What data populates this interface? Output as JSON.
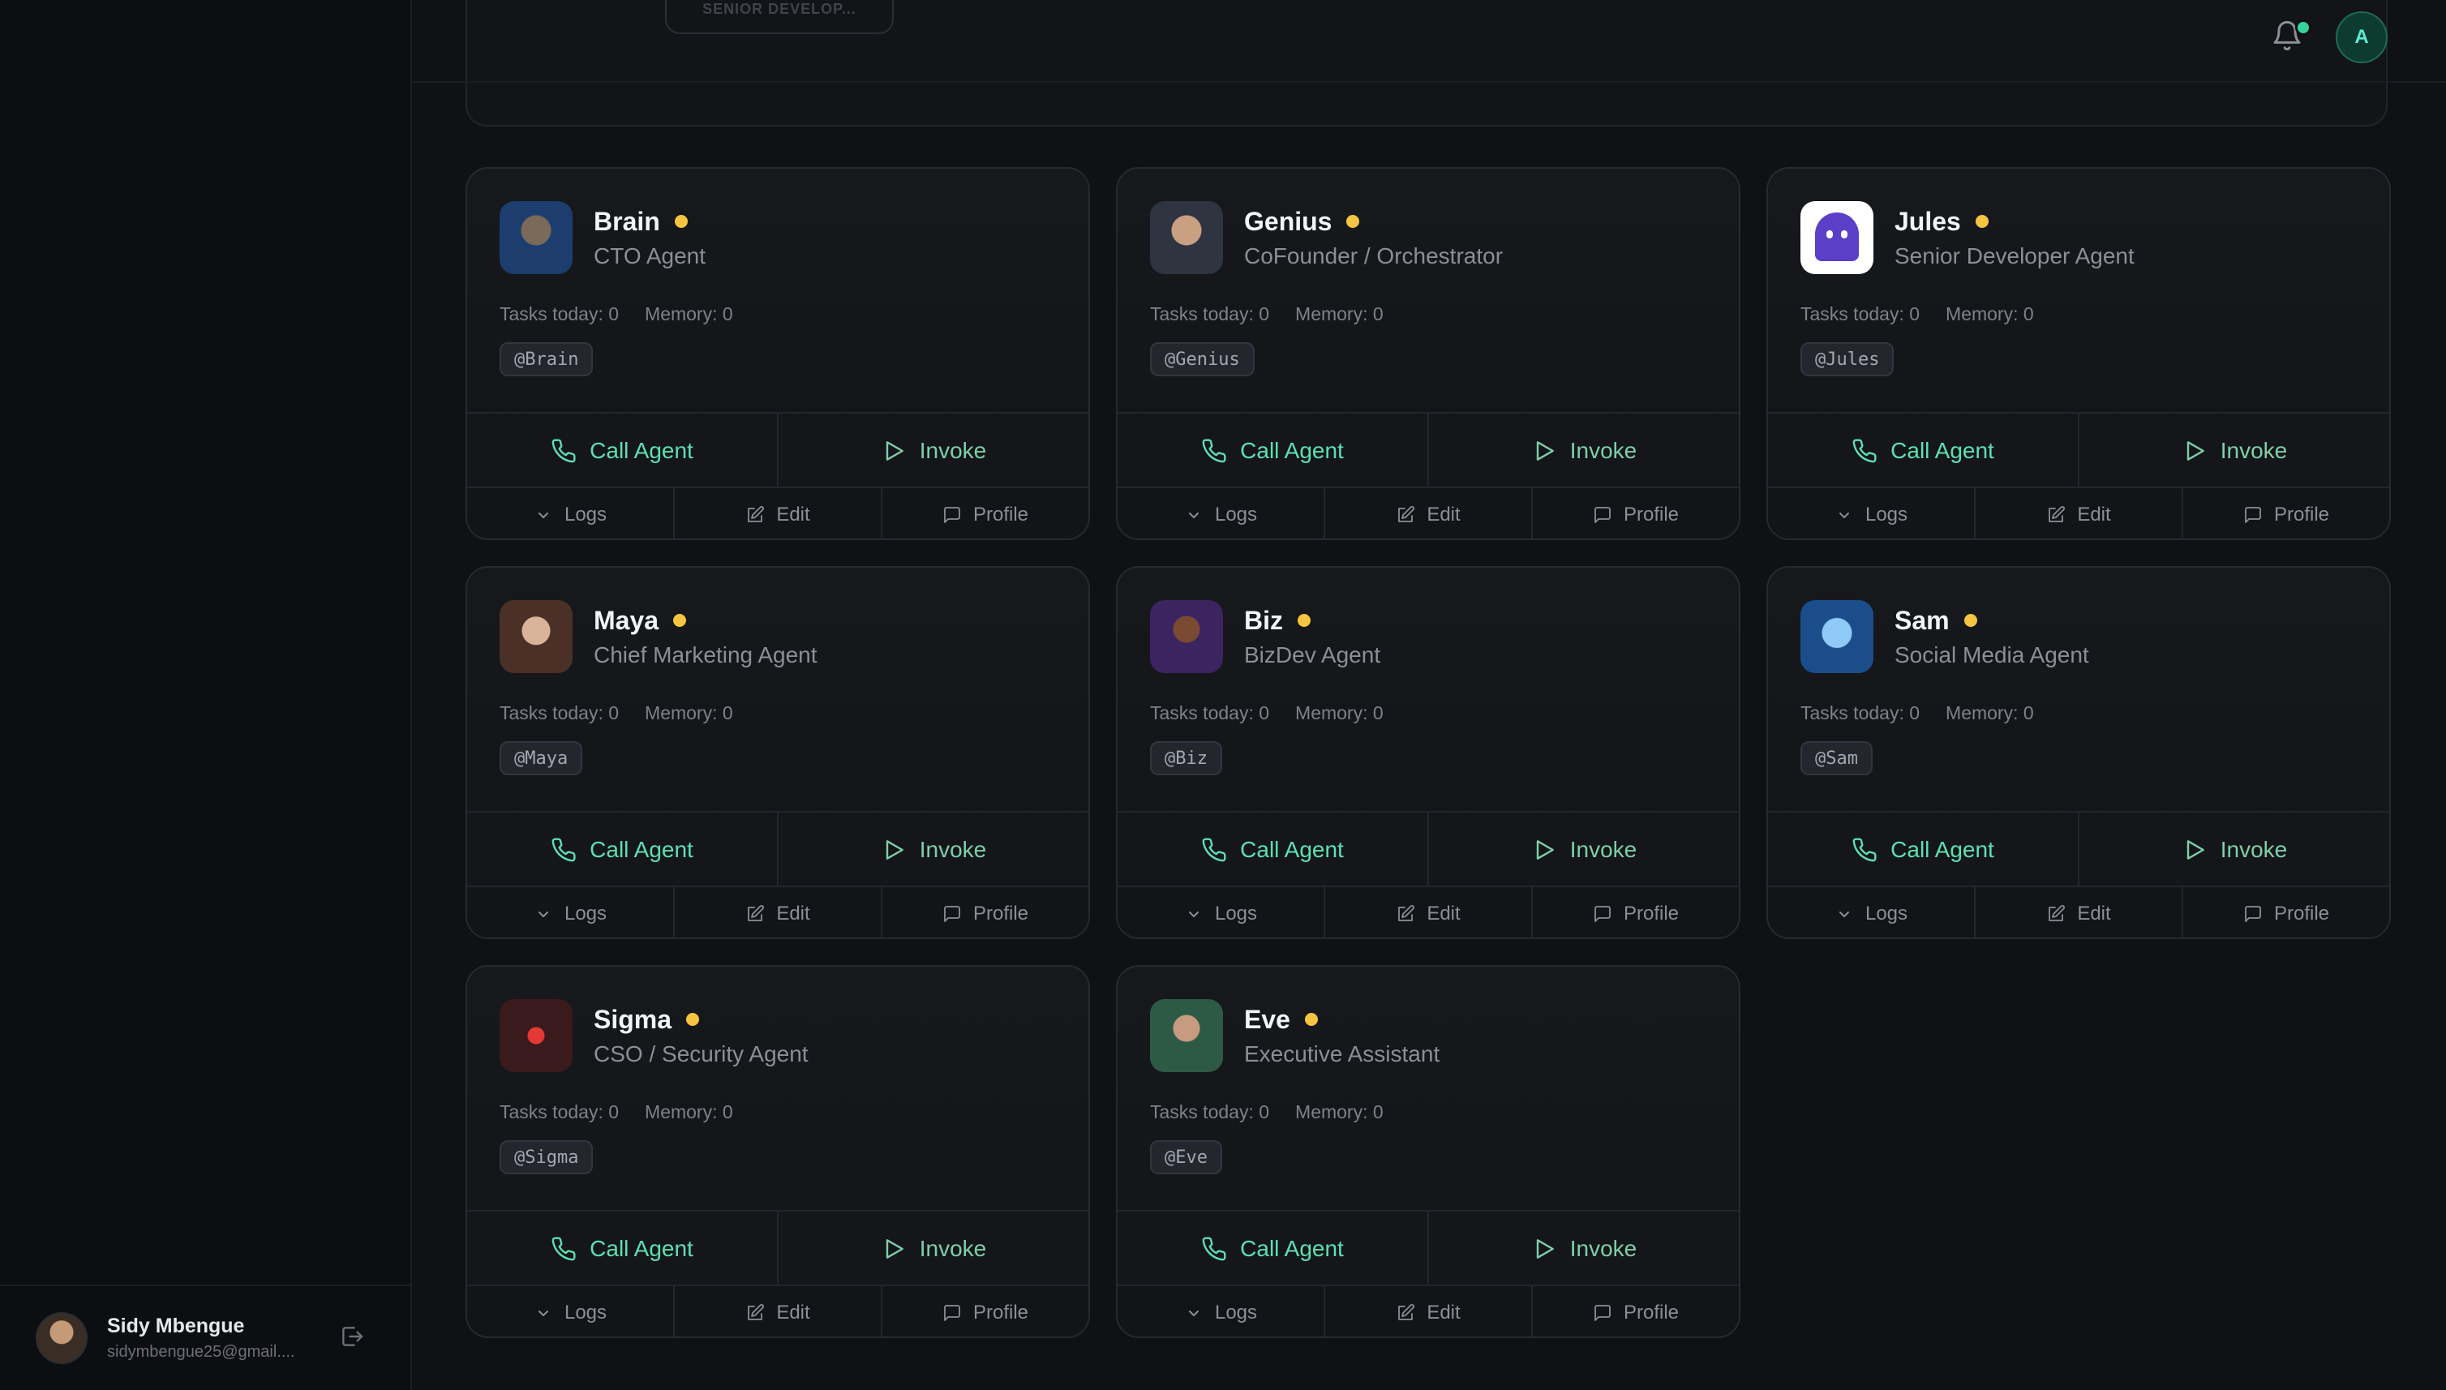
{
  "prev_card": {
    "badge": "SENIOR DEVELOP..."
  },
  "header": {
    "avatar_initial": "A"
  },
  "sidebar": {
    "user": {
      "name": "Sidy Mbengue",
      "email": "sidymbengue25@gmail...."
    }
  },
  "labels": {
    "call": "Call Agent",
    "invoke": "Invoke",
    "logs": "Logs",
    "edit": "Edit",
    "profile": "Profile"
  },
  "agents": [
    {
      "name": "Brain",
      "role": "CTO Agent",
      "tasks": "Tasks today: 0",
      "memory": "Memory: 0",
      "handle": "@Brain",
      "status_color": "#f5c542"
    },
    {
      "name": "Genius",
      "role": "CoFounder / Orchestrator",
      "tasks": "Tasks today: 0",
      "memory": "Memory: 0",
      "handle": "@Genius",
      "status_color": "#f5c542"
    },
    {
      "name": "Jules",
      "role": "Senior Developer Agent",
      "tasks": "Tasks today: 0",
      "memory": "Memory: 0",
      "handle": "@Jules",
      "status_color": "#f5c542"
    },
    {
      "name": "Maya",
      "role": "Chief Marketing Agent",
      "tasks": "Tasks today: 0",
      "memory": "Memory: 0",
      "handle": "@Maya",
      "status_color": "#f5c542"
    },
    {
      "name": "Biz",
      "role": "BizDev Agent",
      "tasks": "Tasks today: 0",
      "memory": "Memory: 0",
      "handle": "@Biz",
      "status_color": "#f5c542"
    },
    {
      "name": "Sam",
      "role": "Social Media Agent",
      "tasks": "Tasks today: 0",
      "memory": "Memory: 0",
      "handle": "@Sam",
      "status_color": "#f5c542"
    },
    {
      "name": "Sigma",
      "role": "CSO / Security Agent",
      "tasks": "Tasks today: 0",
      "memory": "Memory: 0",
      "handle": "@Sigma",
      "status_color": "#f5c542"
    },
    {
      "name": "Eve",
      "role": "Executive Assistant",
      "tasks": "Tasks today: 0",
      "memory": "Memory: 0",
      "handle": "@Eve",
      "status_color": "#f5c542"
    }
  ]
}
